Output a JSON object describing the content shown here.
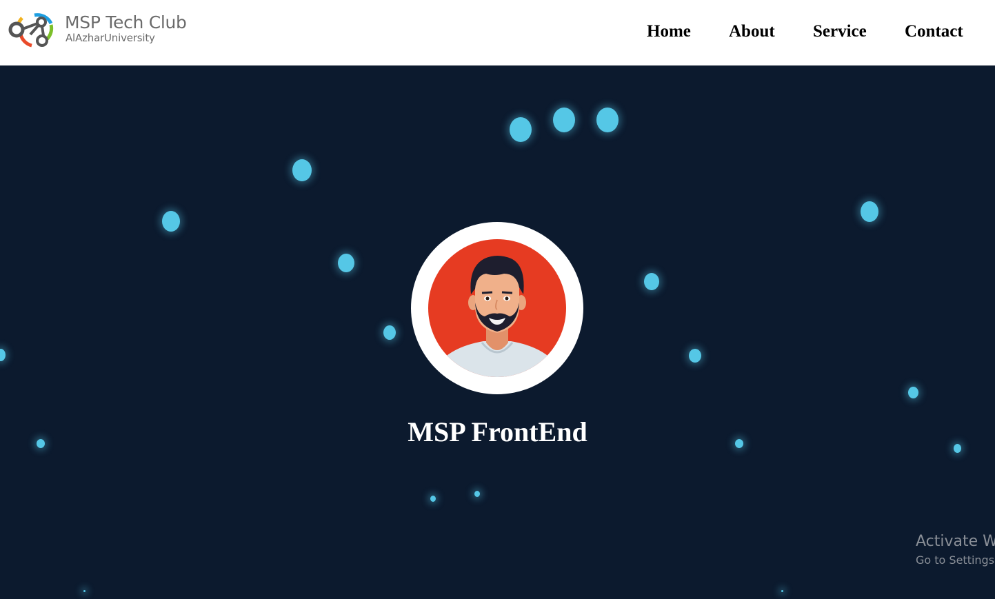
{
  "header": {
    "brand_title": "MSP Tech Club",
    "brand_subtitle": "AlAzharUniversity",
    "logo_icon": "msp-logo-icon",
    "nav": [
      {
        "label": "Home"
      },
      {
        "label": "About"
      },
      {
        "label": "Service"
      },
      {
        "label": "Contact"
      }
    ]
  },
  "hero": {
    "avatar_icon": "person-avatar-icon",
    "name": "MSP FrontEnd"
  },
  "system_overlay": {
    "line1": "Activate W",
    "line2": "Go to Settings"
  },
  "colors": {
    "background": "#0c1a2e",
    "particle": "#55c7e6",
    "avatar_bg": "#e63b22",
    "nav_bg": "#ffffff"
  }
}
